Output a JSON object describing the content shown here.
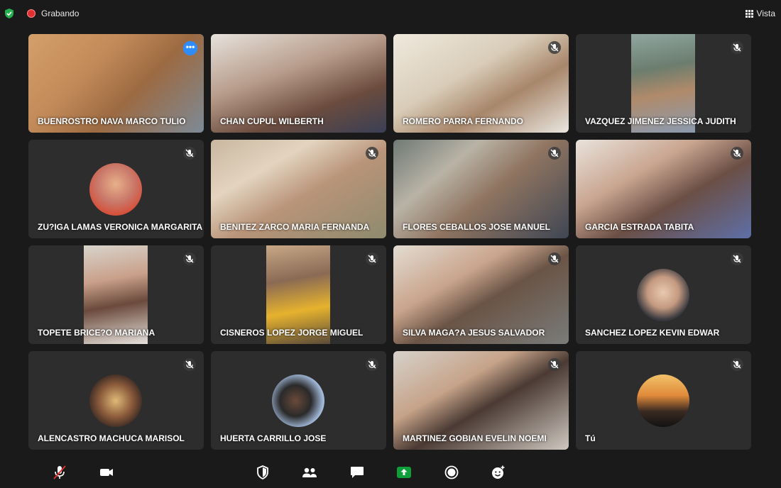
{
  "recording": {
    "label": "Grabando"
  },
  "view": {
    "label": "Vista"
  },
  "participants": [
    {
      "name": "BUENROSTRO NAVA MARCO TULIO",
      "muted": false,
      "active": true,
      "kind": "video"
    },
    {
      "name": "CHAN CUPUL WILBERTH",
      "muted": false,
      "active": false,
      "kind": "video"
    },
    {
      "name": "ROMERO PARRA FERNANDO",
      "muted": true,
      "active": false,
      "kind": "video"
    },
    {
      "name": "VAZQUEZ JIMENEZ JESSICA JUDITH",
      "muted": true,
      "active": false,
      "kind": "video-strip"
    },
    {
      "name": "ZU?IGA LAMAS VERONICA MARGARITA",
      "muted": true,
      "active": false,
      "kind": "avatar"
    },
    {
      "name": "BENITEZ ZARCO MARIA FERNANDA",
      "muted": true,
      "active": false,
      "kind": "video"
    },
    {
      "name": "FLORES CEBALLOS JOSE MANUEL",
      "muted": true,
      "active": false,
      "kind": "video"
    },
    {
      "name": "GARCIA ESTRADA TABITA",
      "muted": true,
      "active": false,
      "kind": "video"
    },
    {
      "name": "TOPETE BRICE?O MARIANA",
      "muted": true,
      "active": false,
      "kind": "video-strip"
    },
    {
      "name": "CISNEROS LOPEZ JORGE MIGUEL",
      "muted": true,
      "active": false,
      "kind": "video-strip"
    },
    {
      "name": "SILVA MAGA?A JESUS SALVADOR",
      "muted": true,
      "active": false,
      "kind": "video"
    },
    {
      "name": "SANCHEZ LOPEZ KEVIN EDWAR",
      "muted": true,
      "active": false,
      "kind": "avatar"
    },
    {
      "name": "ALENCASTRO MACHUCA MARISOL",
      "muted": true,
      "active": false,
      "kind": "avatar"
    },
    {
      "name": "HUERTA CARRILLO JOSE",
      "muted": true,
      "active": false,
      "kind": "avatar"
    },
    {
      "name": "MARTINEZ GOBIAN EVELIN NOEMI",
      "muted": true,
      "active": false,
      "kind": "video"
    },
    {
      "name": "Tú",
      "muted": true,
      "active": false,
      "kind": "avatar"
    }
  ],
  "toolbar": {
    "buttons": [
      "mute-mic",
      "stop-video",
      "security",
      "participants",
      "chat",
      "share-screen",
      "record",
      "reactions"
    ]
  },
  "colors": {
    "accent": "#2d8cff",
    "share": "#0e9f3a",
    "recording": "#e02f2f",
    "tile": "#2d2d2d"
  }
}
